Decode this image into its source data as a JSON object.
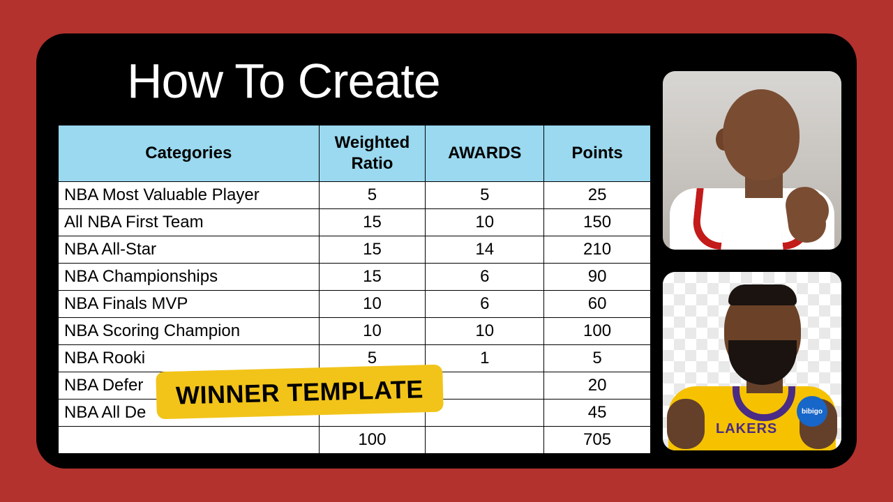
{
  "title": "How To Create",
  "badge_text": "WINNER TEMPLATE",
  "table": {
    "headers": {
      "categories": "Categories",
      "weighted_ratio": "Weighted\nRatio",
      "awards": "AWARDS",
      "points": "Points"
    },
    "rows": [
      {
        "category": "NBA Most Valuable Player",
        "ratio": "5",
        "awards": "5",
        "points": "25"
      },
      {
        "category": "NBA Championships",
        "ratio": "15",
        "awards": "6",
        "points": "90"
      },
      {
        "category": "All NBA First Team",
        "ratio": "15",
        "awards": "10",
        "points": "150"
      },
      {
        "category": "NBA All-Star",
        "ratio": "15",
        "awards": "14",
        "points": "210"
      },
      {
        "category": "NBA Finals MVP",
        "ratio": "10",
        "awards": "6",
        "points": "60"
      },
      {
        "category": "NBA Scoring Champion",
        "ratio": "10",
        "awards": "10",
        "points": "100"
      },
      {
        "category": "NBA Rookie of the Year",
        "ratio": "5",
        "awards": "1",
        "points": "5"
      },
      {
        "category": "NBA Defensive Player",
        "ratio": "",
        "awards": "",
        "points": "20"
      },
      {
        "category": "NBA All Defensive",
        "ratio": "",
        "awards": "",
        "points": "45"
      }
    ],
    "total": {
      "category": "",
      "ratio": "100",
      "awards": "",
      "points": "705"
    }
  },
  "display": {
    "rows_order": [
      0,
      2,
      3,
      1,
      4,
      5,
      6,
      7,
      8
    ],
    "rows_truncated_cat": {
      "6": "NBA Rooki",
      "7": "NBA Defer",
      "8": "NBA All De"
    }
  },
  "photos": {
    "top": {
      "name": "player-photo-jordan",
      "jersey_color": "#ffffff",
      "trim_color": "#c31a1a"
    },
    "bottom": {
      "name": "player-photo-lebron",
      "jersey_color": "#f6c200",
      "collar_color": "#4a2b85",
      "chest_text": "LAKERS",
      "patch_text": "bibigo"
    }
  }
}
